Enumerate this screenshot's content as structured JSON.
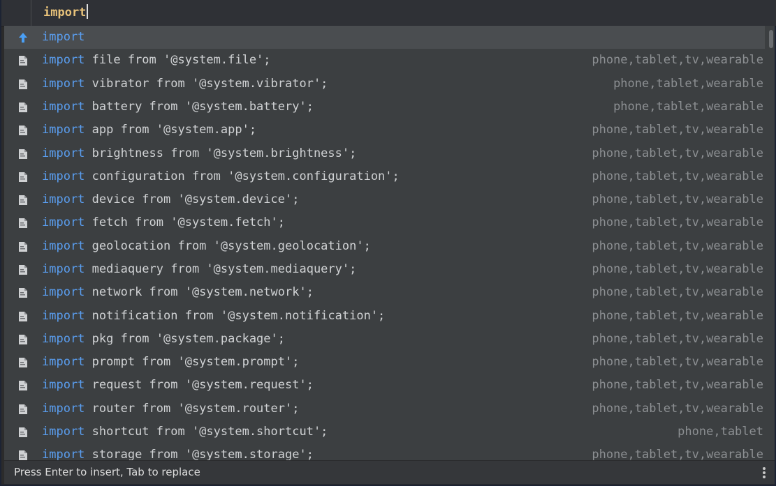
{
  "editor": {
    "typed_text": "import"
  },
  "completion": {
    "selected_item": {
      "label": "import",
      "icon": "arrow-up-icon"
    },
    "items": [
      {
        "keyword": "import",
        "text": " file from '@system.file';",
        "hint": "phone,tablet,tv,wearable"
      },
      {
        "keyword": "import",
        "text": " vibrator from '@system.vibrator';",
        "hint": "phone,tablet,wearable"
      },
      {
        "keyword": "import",
        "text": " battery from '@system.battery';",
        "hint": "phone,tablet,wearable"
      },
      {
        "keyword": "import",
        "text": " app from '@system.app';",
        "hint": "phone,tablet,tv,wearable"
      },
      {
        "keyword": "import",
        "text": " brightness from '@system.brightness';",
        "hint": "phone,tablet,tv,wearable"
      },
      {
        "keyword": "import",
        "text": " configuration from '@system.configuration';",
        "hint": "phone,tablet,tv,wearable"
      },
      {
        "keyword": "import",
        "text": " device from '@system.device';",
        "hint": "phone,tablet,tv,wearable"
      },
      {
        "keyword": "import",
        "text": " fetch from '@system.fetch';",
        "hint": "phone,tablet,tv,wearable"
      },
      {
        "keyword": "import",
        "text": " geolocation from '@system.geolocation';",
        "hint": "phone,tablet,tv,wearable"
      },
      {
        "keyword": "import",
        "text": " mediaquery from '@system.mediaquery';",
        "hint": "phone,tablet,tv,wearable"
      },
      {
        "keyword": "import",
        "text": " network from '@system.network';",
        "hint": "phone,tablet,tv,wearable"
      },
      {
        "keyword": "import",
        "text": " notification from '@system.notification';",
        "hint": "phone,tablet,tv,wearable"
      },
      {
        "keyword": "import",
        "text": " pkg from '@system.package';",
        "hint": "phone,tablet,tv,wearable"
      },
      {
        "keyword": "import",
        "text": " prompt from '@system.prompt';",
        "hint": "phone,tablet,tv,wearable"
      },
      {
        "keyword": "import",
        "text": " request from '@system.request';",
        "hint": "phone,tablet,tv,wearable"
      },
      {
        "keyword": "import",
        "text": " router from '@system.router';",
        "hint": "phone,tablet,tv,wearable"
      },
      {
        "keyword": "import",
        "text": " shortcut from '@system.shortcut';",
        "hint": "phone,tablet"
      },
      {
        "keyword": "import",
        "text": " storage from '@system.storage';",
        "hint": "phone,tablet,tv,wearable"
      }
    ],
    "item_icon": "snippet-file-icon"
  },
  "footer": {
    "hint_text": "Press Enter to insert, Tab to replace",
    "menu_icon": "more-vertical-icon"
  },
  "colors": {
    "keyword": "#5a9ef0",
    "typed": "#e8c27a",
    "hint": "#8c8f92",
    "background": "#3c3f41"
  }
}
